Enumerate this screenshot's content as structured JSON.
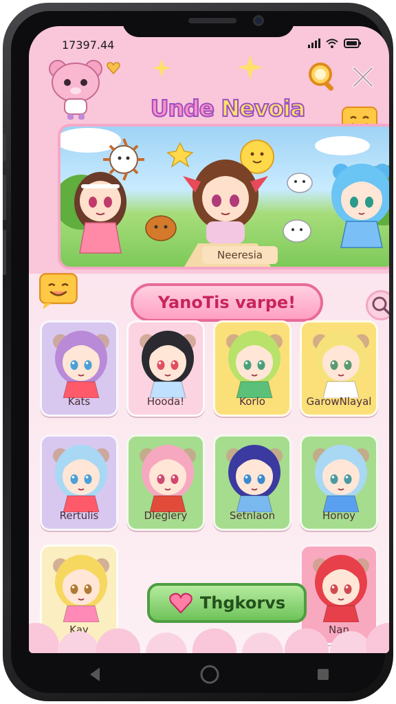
{
  "status_bar": {
    "time": "17397.44"
  },
  "header": {
    "title_part1": "Unde ",
    "title_part2": "Nevoia"
  },
  "hero": {
    "label": "Neeresia"
  },
  "banner": {
    "label": "YanoTis varpe!"
  },
  "cards": [
    {
      "name": "Kats",
      "bg": "#d8c8f0",
      "hair": "#b98ad8",
      "eye": "#4aa0d8",
      "shirt": "#ff5a6a"
    },
    {
      "name": "Hooda!",
      "bg": "#fbd3e1",
      "hair": "#2a2a30",
      "eye": "#e05060",
      "shirt": "#bfe0ff"
    },
    {
      "name": "Korlo",
      "bg": "#fbe07a",
      "hair": "#b8e26a",
      "eye": "#4aa07a",
      "shirt": "#5ac07a"
    },
    {
      "name": "GarowNlayal",
      "bg": "#fbe07a",
      "hair": "#f6e27a",
      "eye": "#5a9a70",
      "shirt": "#ffffff"
    },
    {
      "name": "Rertulis",
      "bg": "#d8c8f0",
      "hair": "#a8d8f4",
      "eye": "#4aa0d8",
      "shirt": "#ff5a6a"
    },
    {
      "name": "Dleglery",
      "bg": "#a6dc8e",
      "hair": "#f6a8c0",
      "eye": "#d04a70",
      "shirt": "#e24a3a"
    },
    {
      "name": "Setnlaon",
      "bg": "#a6dc8e",
      "hair": "#3a3aa0",
      "eye": "#3a8ad0",
      "shirt": "#7ab8f0"
    },
    {
      "name": "Honoy",
      "bg": "#a6dc8e",
      "hair": "#a8d8f4",
      "eye": "#4a9aa0",
      "shirt": "#5aa0f0"
    },
    {
      "name": "Kay",
      "bg": "#fbeec0",
      "hair": "#f6d860",
      "eye": "#b07a30",
      "shirt": "#ff8ab8"
    },
    {
      "name": "Nan",
      "bg": "#f8a9bf",
      "hair": "#e8404a",
      "eye": "#d04a50",
      "shirt": "#e8404a"
    }
  ],
  "thanks_button": {
    "label": "Thgkorvs"
  },
  "icons": {
    "search": "search-icon",
    "close": "close-icon",
    "heart": "heart-icon",
    "back": "back-icon",
    "home": "home-icon",
    "recents": "recents-icon"
  },
  "colors": {
    "accent_pink": "#ff9fc2",
    "accent_green": "#6fc35a",
    "title_purple": "#9a4fc0"
  }
}
